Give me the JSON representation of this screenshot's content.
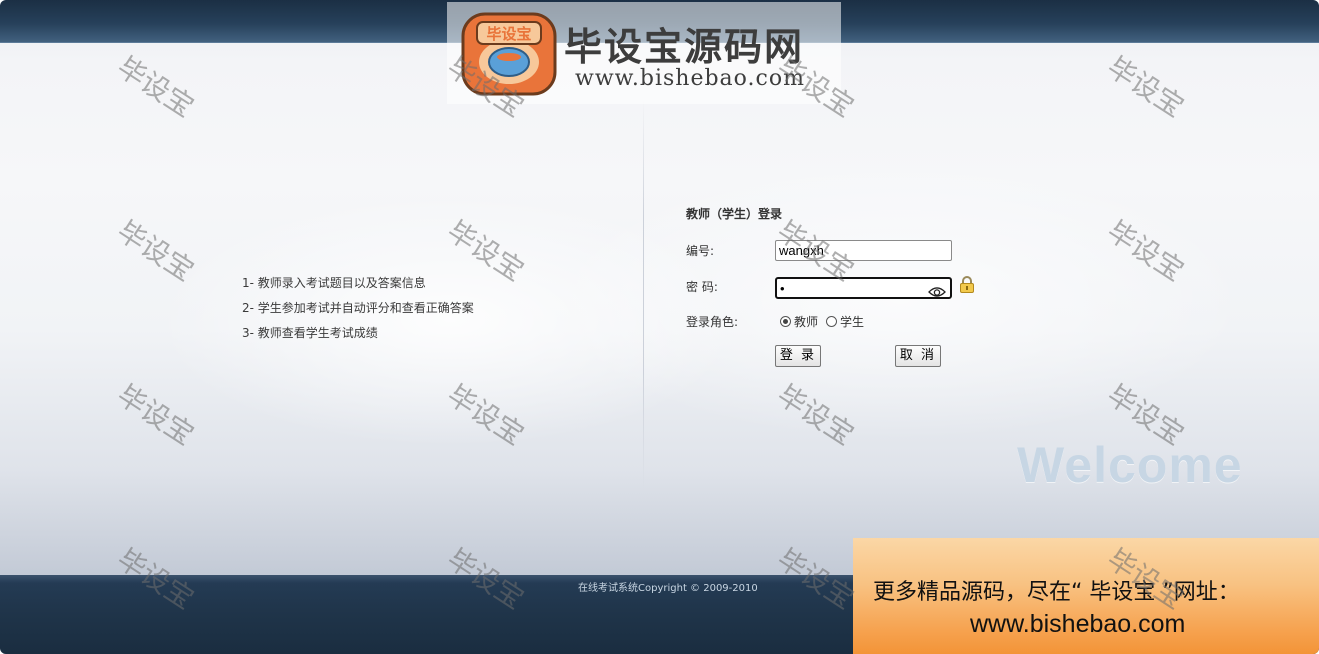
{
  "features": [
    "1- 教师录入考试题目以及答案信息",
    "2- 学生参加考试并自动评分和查看正确答案",
    "3- 教师查看学生考试成绩"
  ],
  "login": {
    "title": "教师（学生）登录",
    "id_label": "编号:",
    "id_value": "wangxh",
    "password_label": "密 码:",
    "password_value": "•",
    "role_label": "登录角色:",
    "roles": [
      {
        "label": "教师",
        "checked": true
      },
      {
        "label": "学生",
        "checked": false
      }
    ],
    "login_button": "登 录",
    "cancel_button": "取 消"
  },
  "welcome_text": "Welcome",
  "footer": {
    "copyright": "在线考试系统Copyright © 2009-2010"
  },
  "banner": {
    "logo_text": "毕设宝",
    "title": "毕设宝源码网",
    "url": "www.bishebao.com"
  },
  "promo": {
    "line1": "更多精品源码，尽在“ 毕设宝 ”网址：",
    "line2": "www.bishebao.com"
  },
  "watermark_text": "毕设宝",
  "colors": {
    "topbar": "#1b2f44",
    "footer": "#1f3449",
    "welcome": "#c7d6e4",
    "promo": "#f6a24f"
  }
}
